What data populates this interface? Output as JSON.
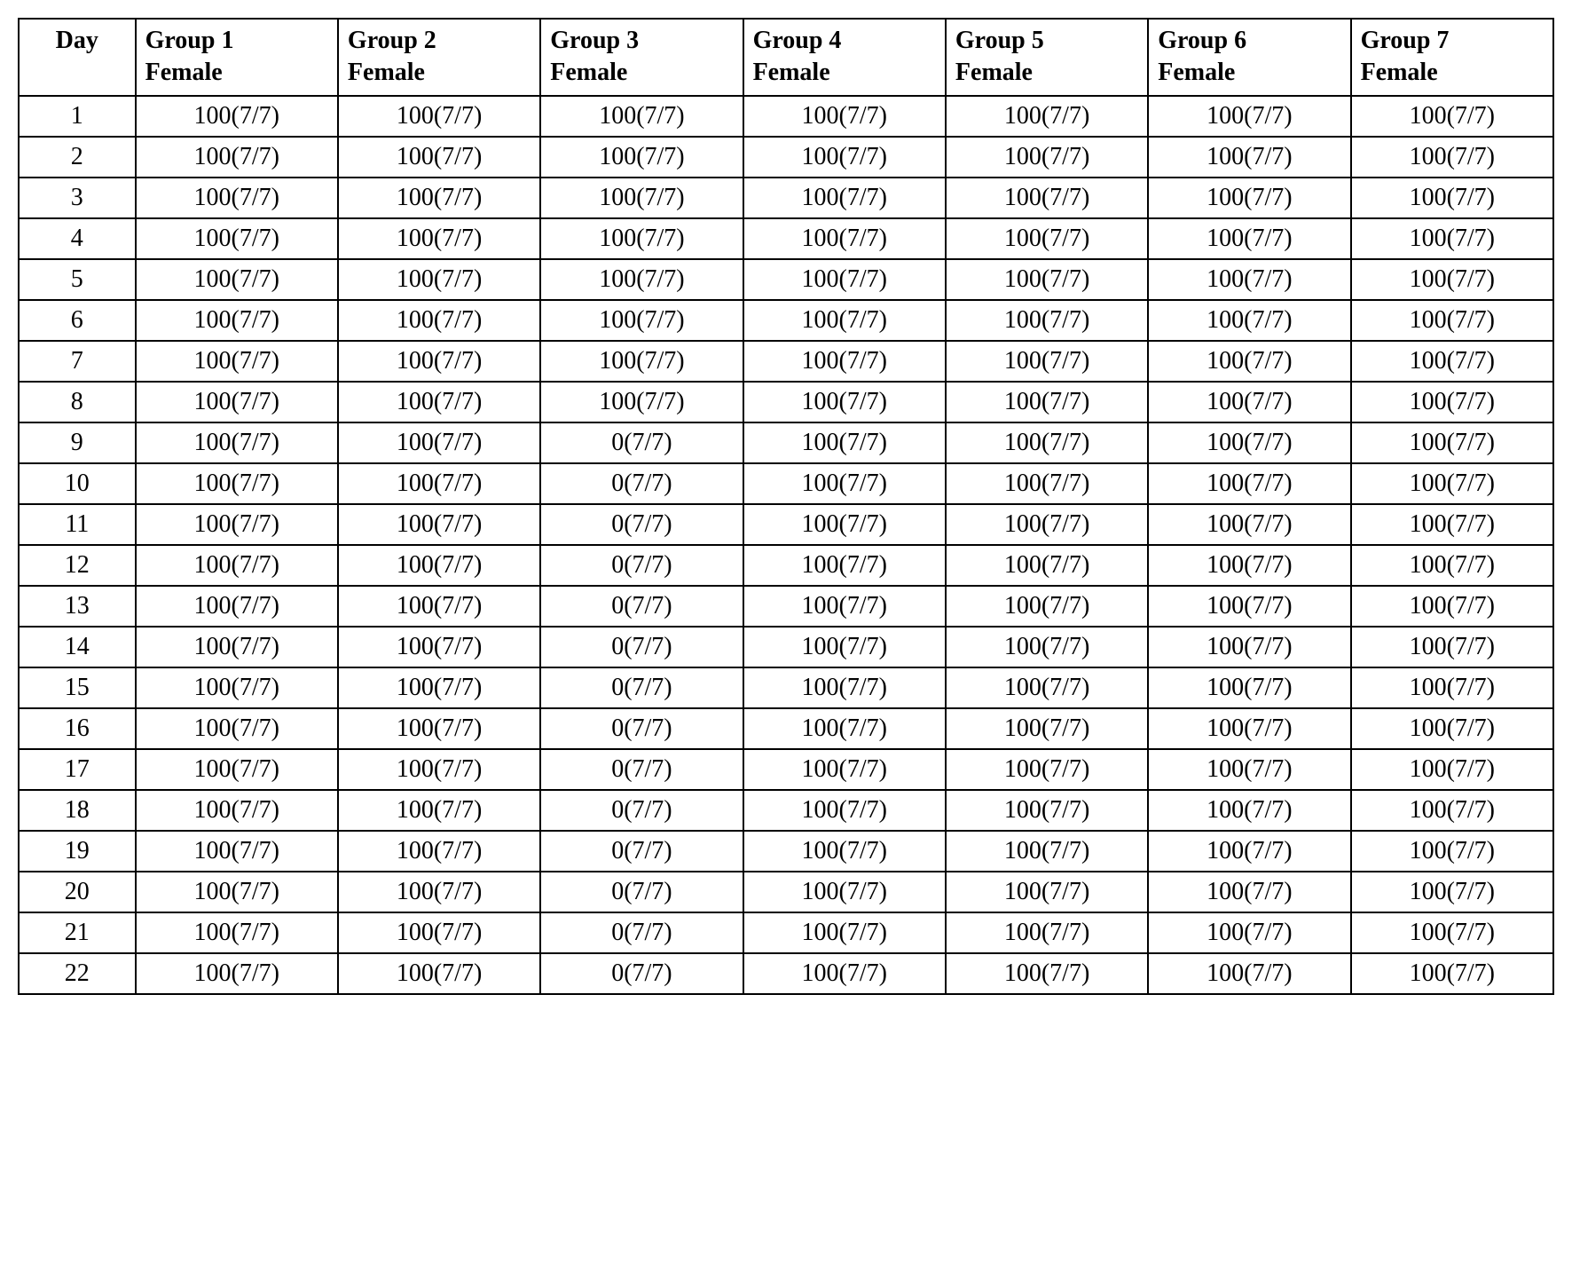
{
  "table": {
    "headers": [
      {
        "id": "day",
        "line1": "Day",
        "line2": ""
      },
      {
        "id": "g1f",
        "line1": "Group 1",
        "line2": "Female"
      },
      {
        "id": "g2f",
        "line1": "Group 2",
        "line2": "Female"
      },
      {
        "id": "g3f",
        "line1": "Group 3",
        "line2": "Female"
      },
      {
        "id": "g4f",
        "line1": "Group 4",
        "line2": "Female"
      },
      {
        "id": "g5f",
        "line1": "Group 5",
        "line2": "Female"
      },
      {
        "id": "g6f",
        "line1": "Group 6",
        "line2": "Female"
      },
      {
        "id": "g7f",
        "line1": "Group 7",
        "line2": "Female"
      }
    ],
    "rows": [
      {
        "day": "1",
        "g1": "100(7/7)",
        "g2": "100(7/7)",
        "g3": "100(7/7)",
        "g4": "100(7/7)",
        "g5": "100(7/7)",
        "g6": "100(7/7)",
        "g7": "100(7/7)"
      },
      {
        "day": "2",
        "g1": "100(7/7)",
        "g2": "100(7/7)",
        "g3": "100(7/7)",
        "g4": "100(7/7)",
        "g5": "100(7/7)",
        "g6": "100(7/7)",
        "g7": "100(7/7)"
      },
      {
        "day": "3",
        "g1": "100(7/7)",
        "g2": "100(7/7)",
        "g3": "100(7/7)",
        "g4": "100(7/7)",
        "g5": "100(7/7)",
        "g6": "100(7/7)",
        "g7": "100(7/7)"
      },
      {
        "day": "4",
        "g1": "100(7/7)",
        "g2": "100(7/7)",
        "g3": "100(7/7)",
        "g4": "100(7/7)",
        "g5": "100(7/7)",
        "g6": "100(7/7)",
        "g7": "100(7/7)"
      },
      {
        "day": "5",
        "g1": "100(7/7)",
        "g2": "100(7/7)",
        "g3": "100(7/7)",
        "g4": "100(7/7)",
        "g5": "100(7/7)",
        "g6": "100(7/7)",
        "g7": "100(7/7)"
      },
      {
        "day": "6",
        "g1": "100(7/7)",
        "g2": "100(7/7)",
        "g3": "100(7/7)",
        "g4": "100(7/7)",
        "g5": "100(7/7)",
        "g6": "100(7/7)",
        "g7": "100(7/7)"
      },
      {
        "day": "7",
        "g1": "100(7/7)",
        "g2": "100(7/7)",
        "g3": "100(7/7)",
        "g4": "100(7/7)",
        "g5": "100(7/7)",
        "g6": "100(7/7)",
        "g7": "100(7/7)"
      },
      {
        "day": "8",
        "g1": "100(7/7)",
        "g2": "100(7/7)",
        "g3": "100(7/7)",
        "g4": "100(7/7)",
        "g5": "100(7/7)",
        "g6": "100(7/7)",
        "g7": "100(7/7)"
      },
      {
        "day": "9",
        "g1": "100(7/7)",
        "g2": "100(7/7)",
        "g3": "0(7/7)",
        "g4": "100(7/7)",
        "g5": "100(7/7)",
        "g6": "100(7/7)",
        "g7": "100(7/7)"
      },
      {
        "day": "10",
        "g1": "100(7/7)",
        "g2": "100(7/7)",
        "g3": "0(7/7)",
        "g4": "100(7/7)",
        "g5": "100(7/7)",
        "g6": "100(7/7)",
        "g7": "100(7/7)"
      },
      {
        "day": "11",
        "g1": "100(7/7)",
        "g2": "100(7/7)",
        "g3": "0(7/7)",
        "g4": "100(7/7)",
        "g5": "100(7/7)",
        "g6": "100(7/7)",
        "g7": "100(7/7)"
      },
      {
        "day": "12",
        "g1": "100(7/7)",
        "g2": "100(7/7)",
        "g3": "0(7/7)",
        "g4": "100(7/7)",
        "g5": "100(7/7)",
        "g6": "100(7/7)",
        "g7": "100(7/7)"
      },
      {
        "day": "13",
        "g1": "100(7/7)",
        "g2": "100(7/7)",
        "g3": "0(7/7)",
        "g4": "100(7/7)",
        "g5": "100(7/7)",
        "g6": "100(7/7)",
        "g7": "100(7/7)"
      },
      {
        "day": "14",
        "g1": "100(7/7)",
        "g2": "100(7/7)",
        "g3": "0(7/7)",
        "g4": "100(7/7)",
        "g5": "100(7/7)",
        "g6": "100(7/7)",
        "g7": "100(7/7)"
      },
      {
        "day": "15",
        "g1": "100(7/7)",
        "g2": "100(7/7)",
        "g3": "0(7/7)",
        "g4": "100(7/7)",
        "g5": "100(7/7)",
        "g6": "100(7/7)",
        "g7": "100(7/7)"
      },
      {
        "day": "16",
        "g1": "100(7/7)",
        "g2": "100(7/7)",
        "g3": "0(7/7)",
        "g4": "100(7/7)",
        "g5": "100(7/7)",
        "g6": "100(7/7)",
        "g7": "100(7/7)"
      },
      {
        "day": "17",
        "g1": "100(7/7)",
        "g2": "100(7/7)",
        "g3": "0(7/7)",
        "g4": "100(7/7)",
        "g5": "100(7/7)",
        "g6": "100(7/7)",
        "g7": "100(7/7)"
      },
      {
        "day": "18",
        "g1": "100(7/7)",
        "g2": "100(7/7)",
        "g3": "0(7/7)",
        "g4": "100(7/7)",
        "g5": "100(7/7)",
        "g6": "100(7/7)",
        "g7": "100(7/7)"
      },
      {
        "day": "19",
        "g1": "100(7/7)",
        "g2": "100(7/7)",
        "g3": "0(7/7)",
        "g4": "100(7/7)",
        "g5": "100(7/7)",
        "g6": "100(7/7)",
        "g7": "100(7/7)"
      },
      {
        "day": "20",
        "g1": "100(7/7)",
        "g2": "100(7/7)",
        "g3": "0(7/7)",
        "g4": "100(7/7)",
        "g5": "100(7/7)",
        "g6": "100(7/7)",
        "g7": "100(7/7)"
      },
      {
        "day": "21",
        "g1": "100(7/7)",
        "g2": "100(7/7)",
        "g3": "0(7/7)",
        "g4": "100(7/7)",
        "g5": "100(7/7)",
        "g6": "100(7/7)",
        "g7": "100(7/7)"
      },
      {
        "day": "22",
        "g1": "100(7/7)",
        "g2": "100(7/7)",
        "g3": "0(7/7)",
        "g4": "100(7/7)",
        "g5": "100(7/7)",
        "g6": "100(7/7)",
        "g7": "100(7/7)"
      }
    ]
  }
}
